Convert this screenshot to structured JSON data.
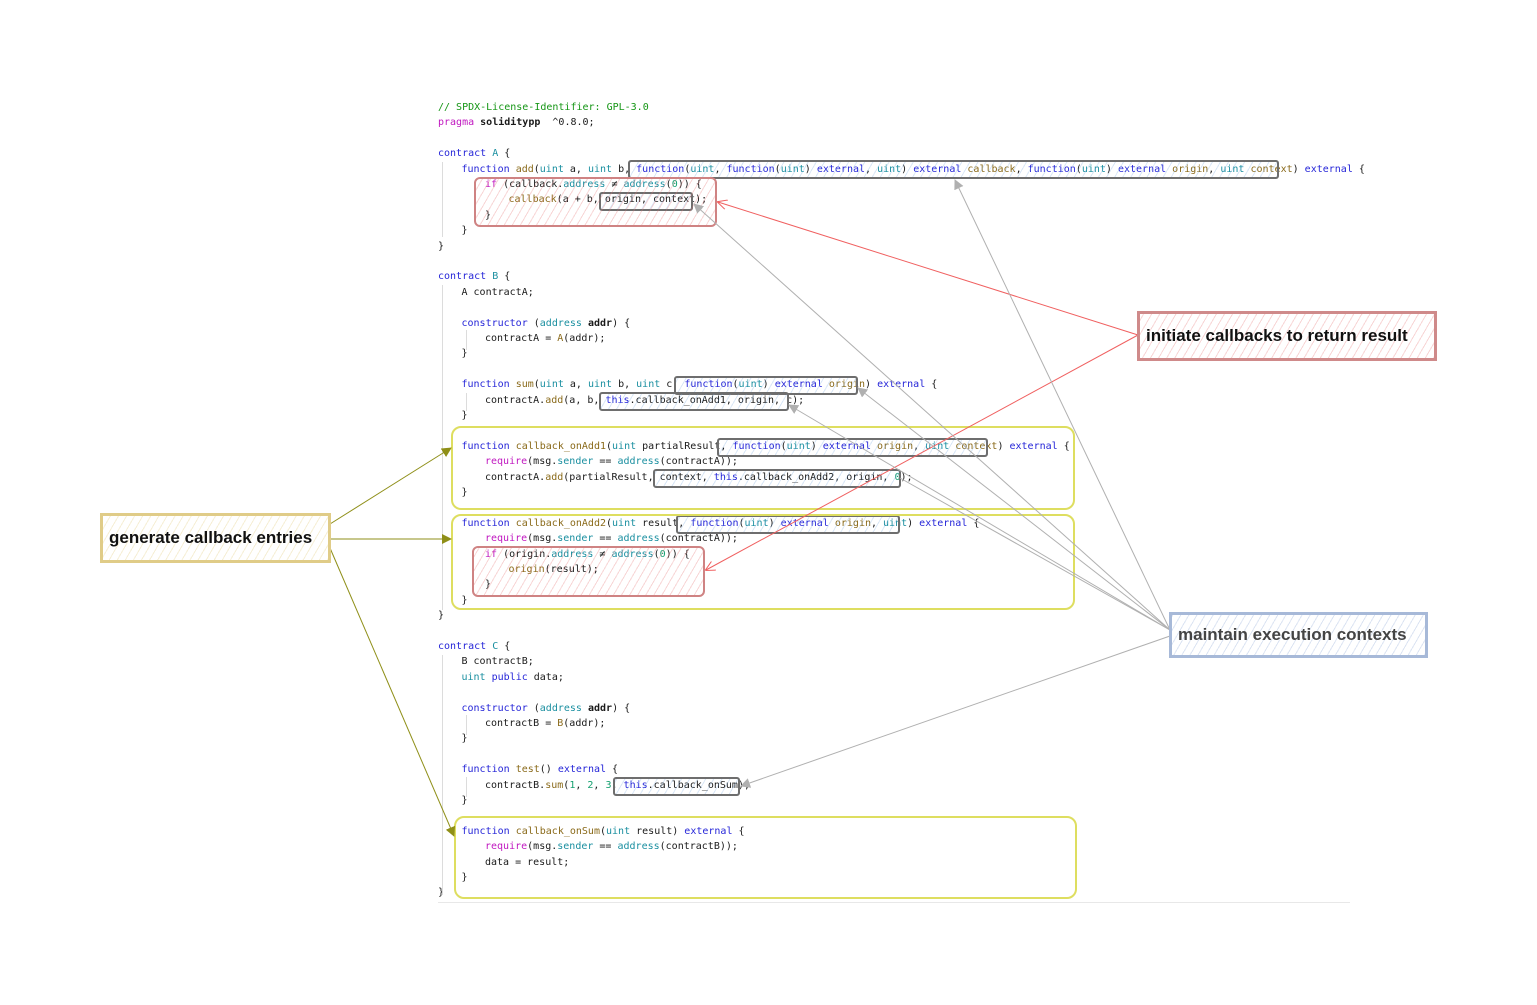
{
  "code": {
    "lines": [
      {
        "y": 0,
        "indent": 0,
        "tokens": [
          [
            "cm",
            "// SPDX-License-Identifier: GPL-3.0"
          ]
        ]
      },
      {
        "y": 1,
        "indent": 0,
        "tokens": [
          [
            "pr",
            "pragma "
          ],
          [
            "b",
            "soliditypp"
          ],
          [
            "",
            "  ^0.8.0;"
          ]
        ]
      },
      {
        "y": 3,
        "indent": 0,
        "tokens": [
          [
            "kw",
            "contract "
          ],
          [
            "ty",
            "A"
          ],
          [
            "",
            " {"
          ]
        ]
      },
      {
        "y": 4,
        "indent": 1,
        "tokens": [
          [
            "kw",
            "function "
          ],
          [
            "fn",
            "add"
          ],
          [
            "",
            "("
          ],
          [
            "ty",
            "uint"
          ],
          [
            "",
            " a, "
          ],
          [
            "ty",
            "uint"
          ],
          [
            "",
            " b, "
          ],
          [
            "kw",
            "function"
          ],
          [
            "",
            "("
          ],
          [
            "ty",
            "uint"
          ],
          [
            ", "
          ],
          [
            "kw",
            "function"
          ],
          [
            "",
            "("
          ],
          [
            "ty",
            "uint"
          ],
          [
            ") "
          ],
          [
            "kw",
            "external"
          ],
          [
            ", "
          ],
          [
            "ty",
            "uint"
          ],
          [
            ") "
          ],
          [
            "kw",
            "external"
          ],
          [
            " "
          ],
          [
            "fn",
            "callback"
          ],
          [
            ", "
          ],
          [
            "kw",
            "function"
          ],
          [
            "",
            "("
          ],
          [
            "ty",
            "uint"
          ],
          [
            ") "
          ],
          [
            "kw",
            "external"
          ],
          [
            " "
          ],
          [
            "fn",
            "origin"
          ],
          [
            ", "
          ],
          [
            "ty",
            "uint"
          ],
          [
            " "
          ],
          [
            "fn",
            "context"
          ],
          [
            ") "
          ],
          [
            "kw",
            "external"
          ],
          [
            " {"
          ]
        ]
      },
      {
        "y": 5,
        "indent": 2,
        "tokens": [
          [
            "pr",
            "if"
          ],
          [
            "",
            " (callback."
          ],
          [
            "ty",
            "address"
          ],
          [
            " ≠ "
          ],
          [
            "ty",
            "address"
          ],
          [
            "("
          ],
          [
            "num",
            "0"
          ],
          [
            ")) {"
          ]
        ]
      },
      {
        "y": 6,
        "indent": 3,
        "tokens": [
          [
            "fn",
            "callback"
          ],
          [
            "",
            "(a + b, origin, context);"
          ]
        ]
      },
      {
        "y": 7,
        "indent": 2,
        "tokens": [
          [
            "",
            "}"
          ]
        ]
      },
      {
        "y": 8,
        "indent": 1,
        "tokens": [
          [
            "",
            "}"
          ]
        ]
      },
      {
        "y": 9,
        "indent": 0,
        "tokens": [
          [
            "",
            "}"
          ]
        ]
      },
      {
        "y": 11,
        "indent": 0,
        "tokens": [
          [
            "kw",
            "contract "
          ],
          [
            "ty",
            "B"
          ],
          [
            "",
            " {"
          ]
        ]
      },
      {
        "y": 12,
        "indent": 1,
        "tokens": [
          [
            "",
            "A contractA;"
          ]
        ]
      },
      {
        "y": 14,
        "indent": 1,
        "tokens": [
          [
            "kw",
            "constructor"
          ],
          [
            "",
            " ("
          ],
          [
            "ty",
            "address"
          ],
          [
            " "
          ],
          [
            "b",
            "addr"
          ],
          [
            ") {"
          ]
        ]
      },
      {
        "y": 15,
        "indent": 2,
        "tokens": [
          [
            "",
            "contractA = "
          ],
          [
            "fn",
            "A"
          ],
          [
            "(addr);"
          ]
        ]
      },
      {
        "y": 16,
        "indent": 1,
        "tokens": [
          [
            "",
            "}"
          ]
        ]
      },
      {
        "y": 18,
        "indent": 1,
        "tokens": [
          [
            "kw",
            "function "
          ],
          [
            "fn",
            "sum"
          ],
          [
            "",
            "("
          ],
          [
            "ty",
            "uint"
          ],
          [
            "",
            " a, "
          ],
          [
            "ty",
            "uint"
          ],
          [
            "",
            " b, "
          ],
          [
            "ty",
            "uint"
          ],
          [
            "",
            " c, "
          ],
          [
            "kw",
            "function"
          ],
          [
            "("
          ],
          [
            "ty",
            "uint"
          ],
          [
            ") "
          ],
          [
            "kw",
            "external"
          ],
          [
            " "
          ],
          [
            "fn",
            "origin"
          ],
          [
            ") "
          ],
          [
            "kw",
            "external"
          ],
          [
            " {"
          ]
        ]
      },
      {
        "y": 19,
        "indent": 2,
        "tokens": [
          [
            "",
            "contractA."
          ],
          [
            "fn",
            "add"
          ],
          [
            "(a, b, "
          ],
          [
            "kw",
            "this"
          ],
          [
            ".callback_onAdd1, origin, c);"
          ]
        ]
      },
      {
        "y": 20,
        "indent": 1,
        "tokens": [
          [
            "",
            "}"
          ]
        ]
      },
      {
        "y": 22,
        "indent": 1,
        "tokens": [
          [
            "kw",
            "function "
          ],
          [
            "fn",
            "callback_onAdd1"
          ],
          [
            "("
          ],
          [
            "ty",
            "uint"
          ],
          [
            " partialResult, "
          ],
          [
            "kw",
            "function"
          ],
          [
            "("
          ],
          [
            "ty",
            "uint"
          ],
          [
            ") "
          ],
          [
            "kw",
            "external"
          ],
          [
            " "
          ],
          [
            "fn",
            "origin"
          ],
          [
            ", "
          ],
          [
            "ty",
            "uint"
          ],
          [
            " "
          ],
          [
            "fn",
            "context"
          ],
          [
            ") "
          ],
          [
            "kw",
            "external"
          ],
          [
            " {"
          ]
        ]
      },
      {
        "y": 23,
        "indent": 2,
        "tokens": [
          [
            "pr",
            "require"
          ],
          [
            "(msg."
          ],
          [
            "ty",
            "sender"
          ],
          [
            " == "
          ],
          [
            "ty",
            "address"
          ],
          [
            "(contractA));"
          ]
        ]
      },
      {
        "y": 24,
        "indent": 2,
        "tokens": [
          [
            "",
            "contractA."
          ],
          [
            "fn",
            "add"
          ],
          [
            "(partialResult, context, "
          ],
          [
            "kw",
            "this"
          ],
          [
            ".callback_onAdd2, origin, "
          ],
          [
            "num",
            "0"
          ],
          [
            ");"
          ]
        ]
      },
      {
        "y": 25,
        "indent": 1,
        "tokens": [
          [
            "",
            "}"
          ]
        ]
      },
      {
        "y": 27,
        "indent": 1,
        "tokens": [
          [
            "kw",
            "function "
          ],
          [
            "fn",
            "callback_onAdd2"
          ],
          [
            "("
          ],
          [
            "ty",
            "uint"
          ],
          [
            " result, "
          ],
          [
            "kw",
            "function"
          ],
          [
            "("
          ],
          [
            "ty",
            "uint"
          ],
          [
            ") "
          ],
          [
            "kw",
            "external"
          ],
          [
            " "
          ],
          [
            "fn",
            "origin"
          ],
          [
            ", "
          ],
          [
            "ty",
            "uint"
          ],
          [
            ") "
          ],
          [
            "kw",
            "external"
          ],
          [
            " {"
          ]
        ]
      },
      {
        "y": 28,
        "indent": 2,
        "tokens": [
          [
            "pr",
            "require"
          ],
          [
            "(msg."
          ],
          [
            "ty",
            "sender"
          ],
          [
            " == "
          ],
          [
            "ty",
            "address"
          ],
          [
            "(contractA));"
          ]
        ]
      },
      {
        "y": 29,
        "indent": 2,
        "tokens": [
          [
            "pr",
            "if"
          ],
          [
            " (origin."
          ],
          [
            "ty",
            "address"
          ],
          [
            " ≠ "
          ],
          [
            "ty",
            "address"
          ],
          [
            "("
          ],
          [
            "num",
            "0"
          ],
          [
            ")) {"
          ]
        ]
      },
      {
        "y": 30,
        "indent": 3,
        "tokens": [
          [
            "fn",
            "origin"
          ],
          [
            "(result);"
          ]
        ]
      },
      {
        "y": 31,
        "indent": 2,
        "tokens": [
          [
            "",
            "}"
          ]
        ]
      },
      {
        "y": 32,
        "indent": 1,
        "tokens": [
          [
            "",
            "}"
          ]
        ]
      },
      {
        "y": 33,
        "indent": 0,
        "tokens": [
          [
            "",
            "}"
          ]
        ]
      },
      {
        "y": 35,
        "indent": 0,
        "tokens": [
          [
            "kw",
            "contract "
          ],
          [
            "ty",
            "C"
          ],
          [
            "",
            " {"
          ]
        ]
      },
      {
        "y": 36,
        "indent": 1,
        "tokens": [
          [
            "",
            "B contractB;"
          ]
        ]
      },
      {
        "y": 37,
        "indent": 1,
        "tokens": [
          [
            "ty",
            "uint"
          ],
          [
            " "
          ],
          [
            "kw",
            "public"
          ],
          [
            " data;"
          ]
        ]
      },
      {
        "y": 39,
        "indent": 1,
        "tokens": [
          [
            "kw",
            "constructor"
          ],
          [
            " ("
          ],
          [
            "ty",
            "address"
          ],
          [
            " "
          ],
          [
            "b",
            "addr"
          ],
          [
            ") {"
          ]
        ]
      },
      {
        "y": 40,
        "indent": 2,
        "tokens": [
          [
            "",
            "contractB = "
          ],
          [
            "fn",
            "B"
          ],
          [
            "(addr);"
          ]
        ]
      },
      {
        "y": 41,
        "indent": 1,
        "tokens": [
          [
            "",
            "}"
          ]
        ]
      },
      {
        "y": 43,
        "indent": 1,
        "tokens": [
          [
            "kw",
            "function "
          ],
          [
            "fn",
            "test"
          ],
          [
            "() "
          ],
          [
            "kw",
            "external"
          ],
          [
            " {"
          ]
        ]
      },
      {
        "y": 44,
        "indent": 2,
        "tokens": [
          [
            "",
            "contractB."
          ],
          [
            "fn",
            "sum"
          ],
          [
            "("
          ],
          [
            "num",
            "1"
          ],
          [
            ", "
          ],
          [
            "num",
            "2"
          ],
          [
            ", "
          ],
          [
            "num",
            "3"
          ],
          [
            ", "
          ],
          [
            "kw",
            "this"
          ],
          [
            ".callback_onSum);"
          ]
        ]
      },
      {
        "y": 45,
        "indent": 1,
        "tokens": [
          [
            "",
            "}"
          ]
        ]
      },
      {
        "y": 47,
        "indent": 1,
        "tokens": [
          [
            "kw",
            "function "
          ],
          [
            "fn",
            "callback_onSum"
          ],
          [
            "("
          ],
          [
            "ty",
            "uint"
          ],
          [
            " result) "
          ],
          [
            "kw",
            "external"
          ],
          [
            " {"
          ]
        ]
      },
      {
        "y": 48,
        "indent": 2,
        "tokens": [
          [
            "pr",
            "require"
          ],
          [
            "(msg."
          ],
          [
            "ty",
            "sender"
          ],
          [
            " == "
          ],
          [
            "ty",
            "address"
          ],
          [
            "(contractB));"
          ]
        ]
      },
      {
        "y": 49,
        "indent": 2,
        "tokens": [
          [
            "",
            "data = result;"
          ]
        ]
      },
      {
        "y": 50,
        "indent": 1,
        "tokens": [
          [
            "",
            "}"
          ]
        ]
      },
      {
        "y": 51,
        "indent": 0,
        "tokens": [
          [
            "",
            "}"
          ]
        ]
      }
    ]
  },
  "annotations": {
    "initiate": "initiate callbacks to return result",
    "generate": "generate callback entries",
    "maintain": "maintain execution contexts"
  },
  "colors": {
    "initiate_accent": "#cf8a8a",
    "generate_accent": "#e0cc88",
    "maintain_accent": "#a7b9d8",
    "arrow_red": "#f06060",
    "arrow_olive": "#8f8f18",
    "arrow_gray": "#b0b0b0"
  }
}
